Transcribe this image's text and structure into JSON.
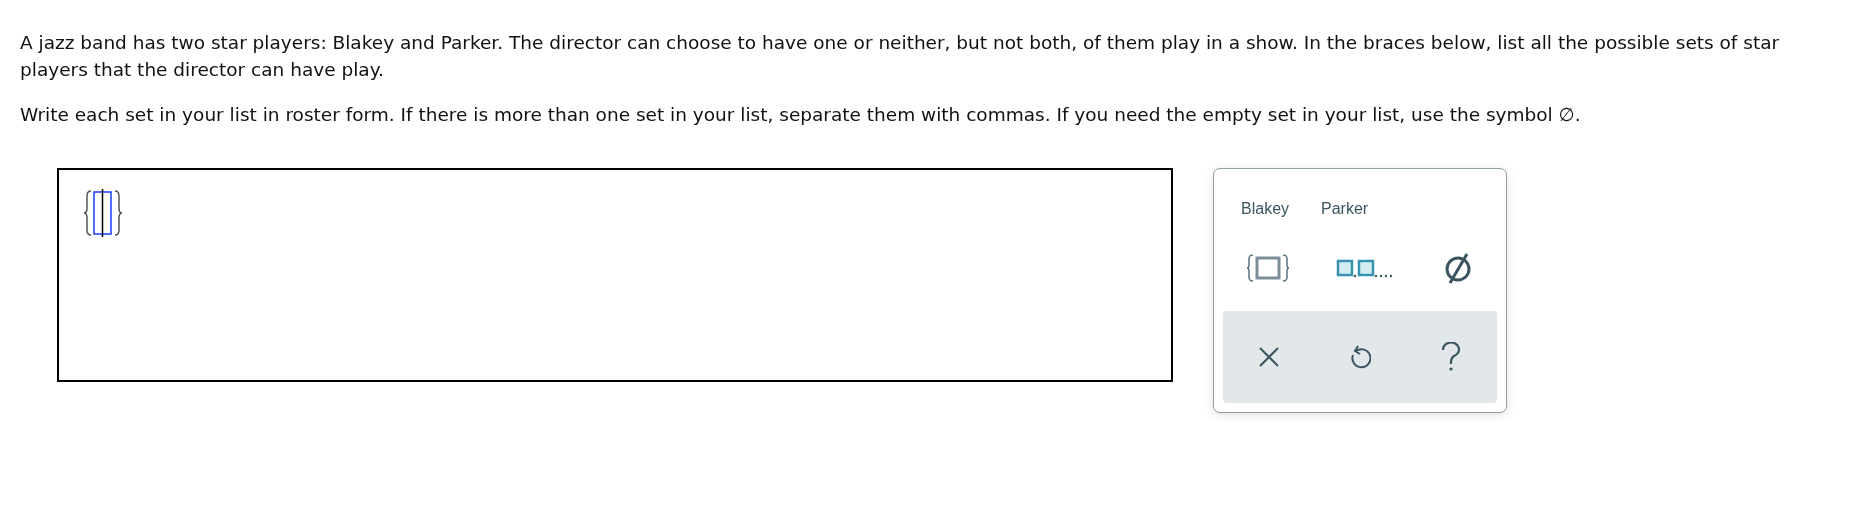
{
  "question": {
    "paragraphs": [
      "A jazz band has two star players: Blakey and Parker. The director can choose to have one or neither, but not both, of them play in a show. In the braces below, list all the possible sets of star players that the director can have play.",
      "Write each set in your list in roster form. If there is more than one set in your list, separate them with commas. If you need the empty set in your list, use the symbol ∅."
    ]
  },
  "palette": {
    "words": [
      "Blakey",
      "Parker"
    ]
  }
}
